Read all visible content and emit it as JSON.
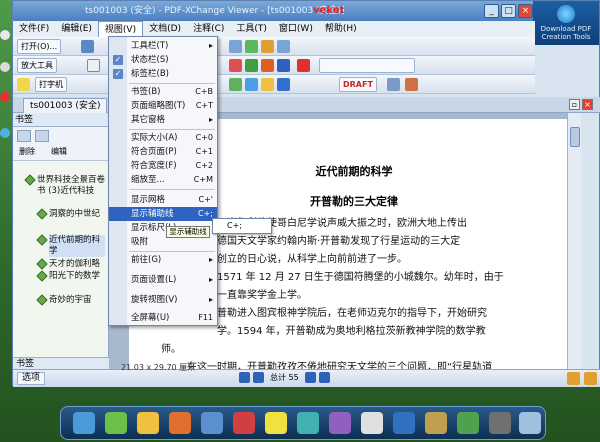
{
  "window": {
    "title": "ts001003 (安全) - PDF-XChange Viewer - [ts001003 (安全)]",
    "brand": "veket",
    "download_badge": "Download PDF Creation Tools"
  },
  "menubar": [
    "文件(F)",
    "编辑(E)",
    "视图(V)",
    "文档(D)",
    "注释(C)",
    "工具(T)",
    "窗口(W)",
    "帮助(H)"
  ],
  "toolbar": {
    "open": "打开(O)...",
    "zoom_tool": "放大工具",
    "typewriter": "打字机",
    "draft_stamp": "DRAFT"
  },
  "tab": {
    "label": "ts001003 (安全)"
  },
  "panel": {
    "header": "书签",
    "delete": "删除",
    "edit": "编辑",
    "footer": "书签",
    "bookmarks": [
      "世界科技全景百卷书 (3)近代科技",
      "洞察的中世纪",
      "近代前期的科学",
      "天才的伽利略",
      "阳光下的数学",
      "奇妙的宇宙"
    ]
  },
  "view_menu": {
    "items": [
      {
        "label": "工具栏(T)",
        "key": "▸",
        "check": false
      },
      {
        "label": "状态栏(S)",
        "key": "",
        "check": true
      },
      {
        "label": "标签栏(B)",
        "key": "",
        "check": true
      },
      {
        "label": "书签(B)",
        "key": "C+B",
        "check": false
      },
      {
        "label": "页面缩略图(T)",
        "key": "C+T",
        "check": false
      },
      {
        "label": "其它窗格",
        "key": "▸",
        "check": false
      },
      {
        "label": "实际大小(A)",
        "key": "C+0",
        "check": false
      },
      {
        "label": "符合页面(P)",
        "key": "C+1",
        "check": false
      },
      {
        "label": "符合宽度(F)",
        "key": "C+2",
        "check": false
      },
      {
        "label": "缩放至...",
        "key": "C+M",
        "check": false
      },
      {
        "label": "显示网格",
        "key": "C+'",
        "check": false
      },
      {
        "label": "显示辅助线",
        "key": "C+;",
        "check": false
      },
      {
        "label": "显示标尺(L)",
        "key": "",
        "check": false
      },
      {
        "label": "吸附",
        "key": "",
        "check": false
      },
      {
        "label": "前往(G)",
        "key": "▸",
        "check": false
      },
      {
        "label": "页面设置(L)",
        "key": "▸",
        "check": false
      },
      {
        "label": "旋转视图(V)",
        "key": "▸",
        "check": false
      },
      {
        "label": "全屏幕(U)",
        "key": "F11",
        "check": false
      }
    ],
    "submenu_item": "显示辅助线",
    "submenu_key": "C+;",
    "tooltip": "显示辅助线"
  },
  "document": {
    "title1": "近代前期的科学",
    "title2": "开普勒的三大定律",
    "lines": [
      "正当伽利略使哥白尼学说声威大振之时，欧洲大地上传出",
      "德国天文学家约翰内斯·开普勒发现了行星运动的三大定",
      "创立的日心说，从科学上向前前进了一步。",
      "1571 年 12 月 27 日生于德国符腾堡的小城魏尔。幼年时，由于",
      "一直靠奖学金上学。",
      "普勒进入图宾根神学院后，在老师迈克尔的指导下，开始研究",
      "学。1594 年，开普勒成为奥地利格拉茨新教神学院的数学教",
      "师。",
      "在这一时期，开普勒孜孜不倦地研究天文学的三个问题，即“行星轨道"
    ]
  },
  "status": {
    "size": "21.03 x 29.70 厘米",
    "options": "选项",
    "page_total": "总计 55"
  }
}
